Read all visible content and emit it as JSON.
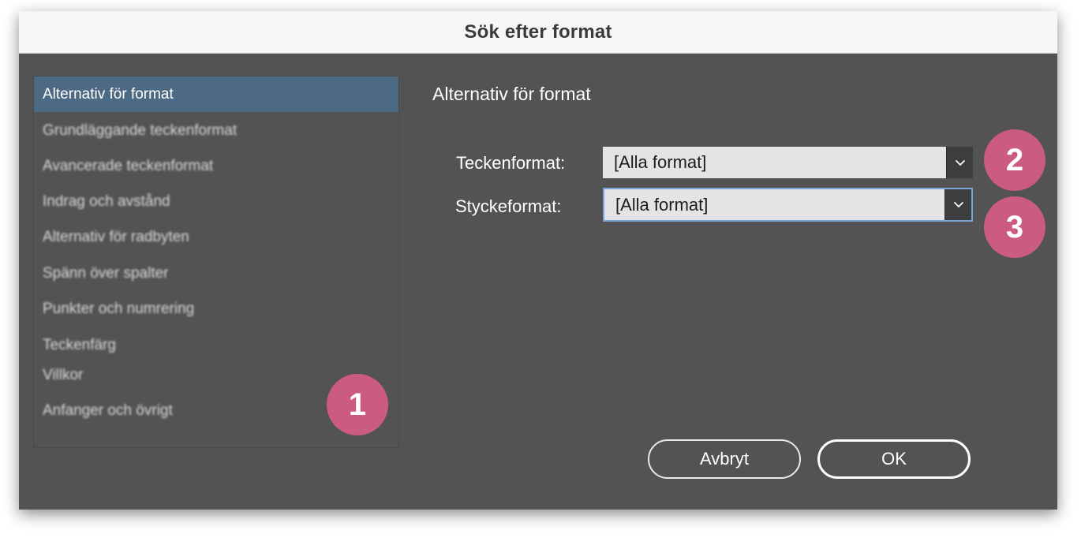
{
  "window": {
    "title": "Sök efter format"
  },
  "sidebar": {
    "items": [
      {
        "label": "Alternativ för format",
        "selected": true
      },
      {
        "label": "Grundläggande teckenformat",
        "selected": false
      },
      {
        "label": "Avancerade teckenformat",
        "selected": false
      },
      {
        "label": "Indrag och avstånd",
        "selected": false
      },
      {
        "label": "Alternativ för radbyten",
        "selected": false
      },
      {
        "label": "Spänn över spalter",
        "selected": false
      },
      {
        "label": "Punkter och numrering",
        "selected": false
      },
      {
        "label": "Teckenfärg",
        "selected": false
      },
      {
        "label": "Villkor",
        "selected": false
      },
      {
        "label": "Anfanger och övrigt",
        "selected": false
      }
    ]
  },
  "main": {
    "heading": "Alternativ för format",
    "character_style": {
      "label": "Teckenformat:",
      "value": "[Alla format]"
    },
    "paragraph_style": {
      "label": "Styckeformat:",
      "value": "[Alla format]"
    }
  },
  "badges": {
    "one": "1",
    "two": "2",
    "three": "3"
  },
  "buttons": {
    "cancel": "Avbryt",
    "ok": "OK"
  },
  "colors": {
    "dialog_bg": "#535353",
    "selection": "#4d6a85",
    "badge": "#cc5b84",
    "focus": "#7aa3d6"
  },
  "icons": {
    "dropdown": "chevron-down-icon"
  }
}
